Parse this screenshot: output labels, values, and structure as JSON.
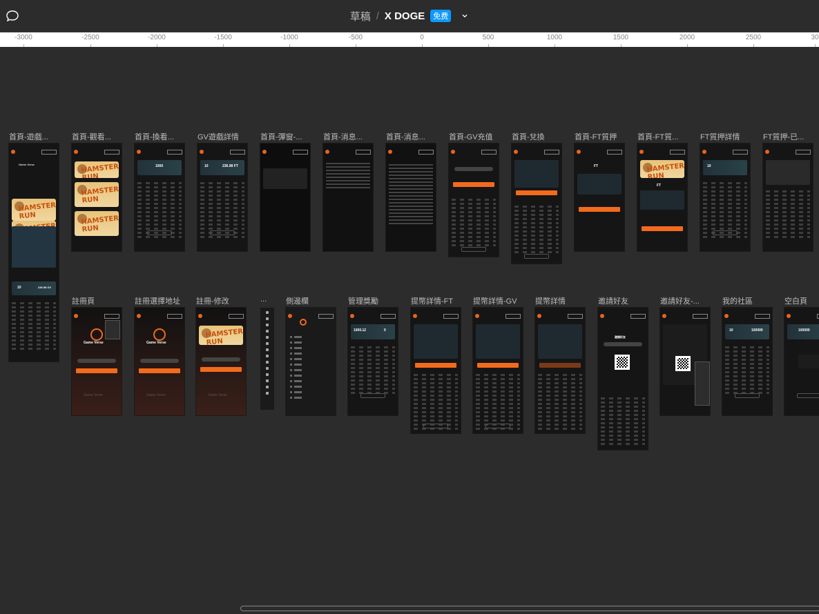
{
  "header": {
    "draft_label": "草稿",
    "separator": "/",
    "file_name": "X DOGE",
    "plan_badge": "免费"
  },
  "ruler": {
    "ticks": [
      "-3000",
      "-2500",
      "-2000",
      "-1500",
      "-1000",
      "-500",
      "0",
      "500",
      "1000",
      "1500",
      "2000",
      "2500",
      "30"
    ]
  },
  "frames_row1": [
    {
      "label": "首頁-遊戲..."
    },
    {
      "label": "首頁-觀看..."
    },
    {
      "label": "首頁-換看..."
    },
    {
      "label": "GV遊戲詳情"
    },
    {
      "label": "首頁-彈窗-..."
    },
    {
      "label": "首頁-消息..."
    },
    {
      "label": "首頁-消息..."
    },
    {
      "label": "首頁-GV充值"
    },
    {
      "label": "首頁-兌換"
    },
    {
      "label": "首頁-FT質押"
    },
    {
      "label": "首頁-FT質..."
    },
    {
      "label": "FT質押詳情"
    },
    {
      "label": "FT質押-已..."
    }
  ],
  "frames_row2": [
    {
      "label": "註冊頁"
    },
    {
      "label": "註冊選擇地址"
    },
    {
      "label": "註冊-修改"
    },
    {
      "label": "..."
    },
    {
      "label": "側邊欄"
    },
    {
      "label": "管理獎勵"
    },
    {
      "label": "提幣詳情-FT"
    },
    {
      "label": "提幣詳情-GV"
    },
    {
      "label": "提幣詳情"
    },
    {
      "label": "邀請好友"
    },
    {
      "label": "邀請好友-..."
    },
    {
      "label": "我的社區"
    },
    {
      "label": "空白頁"
    }
  ],
  "frame_texts": {
    "hamster_run": "HAMSTER RUN",
    "game_verse": "Game Verse",
    "gv_balance": "236.98 GV",
    "ft_balance": "236.98 FT",
    "amount_1000": "1000",
    "amount_10": "10",
    "reward": "1000.12",
    "zero": "0",
    "count_100000": "100000",
    "invite_title": "邀請好友",
    "ft_label": "FT"
  }
}
